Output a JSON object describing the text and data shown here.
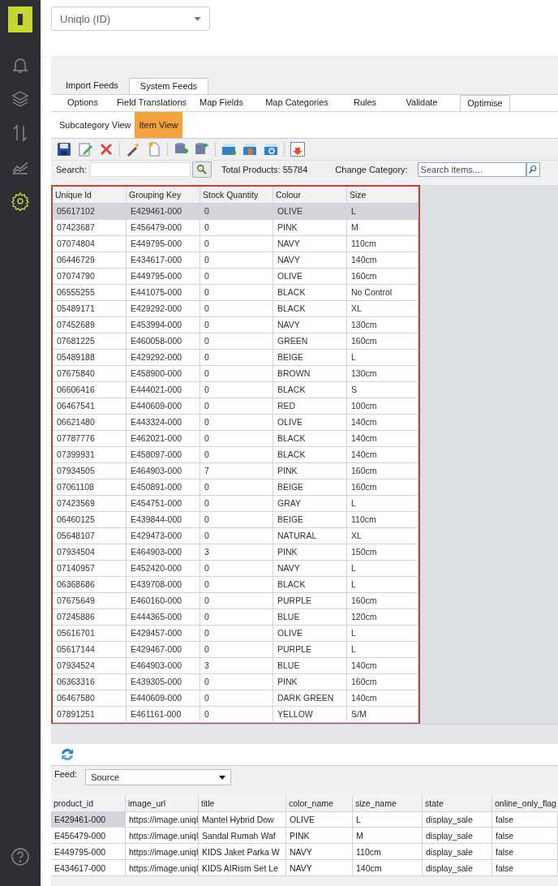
{
  "sidebar": {
    "items": [
      {
        "kind": "bell",
        "selected": false
      },
      {
        "kind": "layers",
        "selected": false
      },
      {
        "kind": "transfer",
        "selected": false
      },
      {
        "kind": "chart",
        "selected": false
      },
      {
        "kind": "gear",
        "selected": true
      }
    ],
    "bottom_items": [
      {
        "kind": "help"
      }
    ]
  },
  "store_select": {
    "value": "Uniqlo (ID)"
  },
  "feed_tabs": [
    {
      "label": "Import Feeds",
      "selected": false
    },
    {
      "label": "System Feeds",
      "selected": true
    }
  ],
  "step_tabs": [
    {
      "label": "Options",
      "selected": false
    },
    {
      "label": "Field Translations",
      "selected": false
    },
    {
      "label": "Map Fields",
      "selected": false
    },
    {
      "label": "Map Categories",
      "selected": false
    },
    {
      "label": "Rules",
      "selected": false
    },
    {
      "label": "Validate",
      "selected": false
    },
    {
      "label": "Optimise",
      "selected": true
    }
  ],
  "view_tabs": [
    {
      "label": "Subcategory View",
      "selected": false
    },
    {
      "label": "Item View",
      "selected": true
    }
  ],
  "search_bar": {
    "search_label": "Search:",
    "total": "Total Products: 55784",
    "category_label": "Change Category:",
    "items_placeholder": "Search items...."
  },
  "table": {
    "columns": [
      "Unique Id",
      "Grouping Key",
      "Stock Quantity",
      "Colour",
      "Size"
    ],
    "rows": [
      {
        "cells": [
          "05617102",
          "E429461-000",
          "0",
          "OLIVE",
          "L"
        ],
        "selected": true
      },
      {
        "cells": [
          "07423687",
          "E456479-000",
          "0",
          "PINK",
          "M"
        ],
        "selected": false
      },
      {
        "cells": [
          "07074804",
          "E449795-000",
          "0",
          "NAVY",
          "110cm"
        ],
        "selected": false
      },
      {
        "cells": [
          "06446729",
          "E434617-000",
          "0",
          "NAVY",
          "140cm"
        ],
        "selected": false
      },
      {
        "cells": [
          "07074790",
          "E449795-000",
          "0",
          "OLIVE",
          "160cm"
        ],
        "selected": false
      },
      {
        "cells": [
          "06555255",
          "E441075-000",
          "0",
          "BLACK",
          "No Control"
        ],
        "selected": false
      },
      {
        "cells": [
          "05489171",
          "E429292-000",
          "0",
          "BLACK",
          "XL"
        ],
        "selected": false
      },
      {
        "cells": [
          "07452689",
          "E453994-000",
          "0",
          "NAVY",
          "130cm"
        ],
        "selected": false
      },
      {
        "cells": [
          "07681225",
          "E460058-000",
          "0",
          "GREEN",
          "160cm"
        ],
        "selected": false
      },
      {
        "cells": [
          "05489188",
          "E429292-000",
          "0",
          "BEIGE",
          "L"
        ],
        "selected": false
      },
      {
        "cells": [
          "07675840",
          "E458900-000",
          "0",
          "BROWN",
          "130cm"
        ],
        "selected": false
      },
      {
        "cells": [
          "06606416",
          "E444021-000",
          "0",
          "BLACK",
          "S"
        ],
        "selected": false
      },
      {
        "cells": [
          "06467541",
          "E440609-000",
          "0",
          "RED",
          "100cm"
        ],
        "selected": false
      },
      {
        "cells": [
          "06621480",
          "E443324-000",
          "0",
          "OLIVE",
          "140cm"
        ],
        "selected": false
      },
      {
        "cells": [
          "07787776",
          "E462021-000",
          "0",
          "BLACK",
          "140cm"
        ],
        "selected": false
      },
      {
        "cells": [
          "07399931",
          "E458097-000",
          "0",
          "BLACK",
          "140cm"
        ],
        "selected": false
      },
      {
        "cells": [
          "07934505",
          "E464903-000",
          "7",
          "PINK",
          "160cm"
        ],
        "selected": false
      },
      {
        "cells": [
          "07061108",
          "E450891-000",
          "0",
          "BEIGE",
          "160cm"
        ],
        "selected": false
      },
      {
        "cells": [
          "07423569",
          "E454751-000",
          "0",
          "GRAY",
          "L"
        ],
        "selected": false
      },
      {
        "cells": [
          "06460125",
          "E439844-000",
          "0",
          "BEIGE",
          "110cm"
        ],
        "selected": false
      },
      {
        "cells": [
          "05648107",
          "E429473-000",
          "0",
          "NATURAL",
          "XL"
        ],
        "selected": false
      },
      {
        "cells": [
          "07934504",
          "E464903-000",
          "3",
          "PINK",
          "150cm"
        ],
        "selected": false
      },
      {
        "cells": [
          "07140957",
          "E452420-000",
          "0",
          "NAVY",
          "L"
        ],
        "selected": false
      },
      {
        "cells": [
          "06368686",
          "E439708-000",
          "0",
          "BLACK",
          "L"
        ],
        "selected": false
      },
      {
        "cells": [
          "07675649",
          "E460160-000",
          "0",
          "PURPLE",
          "160cm"
        ],
        "selected": false
      },
      {
        "cells": [
          "07245886",
          "E444365-000",
          "0",
          "BLUE",
          "120cm"
        ],
        "selected": false
      },
      {
        "cells": [
          "05616701",
          "E429457-000",
          "0",
          "OLIVE",
          "L"
        ],
        "selected": false
      },
      {
        "cells": [
          "05617144",
          "E429467-000",
          "0",
          "PURPLE",
          "L"
        ],
        "selected": false
      },
      {
        "cells": [
          "07934524",
          "E464903-000",
          "3",
          "BLUE",
          "140cm"
        ],
        "selected": false
      },
      {
        "cells": [
          "06363316",
          "E439305-000",
          "0",
          "PINK",
          "160cm"
        ],
        "selected": false
      },
      {
        "cells": [
          "06467580",
          "E440609-000",
          "0",
          "DARK GREEN",
          "140cm"
        ],
        "selected": false
      },
      {
        "cells": [
          "07891251",
          "E461161-000",
          "0",
          "YELLOW",
          "S/M"
        ],
        "selected": false
      }
    ]
  },
  "feed": {
    "label": "Feed:",
    "value": "Source"
  },
  "feed_table": {
    "columns": [
      "product_id",
      "image_url",
      "title",
      "color_name",
      "size_name",
      "state",
      "online_only_flag"
    ],
    "rows": [
      {
        "cells": [
          "E429461-000",
          "https://image.uniql",
          "Mantel Hybrid Dow",
          "OLIVE",
          "L",
          "display_sale",
          "false"
        ],
        "selected": true
      },
      {
        "cells": [
          "E456479-000",
          "https://image.uniql",
          "Sandal Rumah Waf",
          "PINK",
          "M",
          "display_sale",
          "false"
        ],
        "selected": false
      },
      {
        "cells": [
          "E449795-000",
          "https://image.uniql",
          "KIDS Jaket Parka W",
          "NAVY",
          "110cm",
          "display_sale",
          "false"
        ],
        "selected": false
      },
      {
        "cells": [
          "E434617-000",
          "https://image.uniql",
          "KIDS AIRism Set Le",
          "NAVY",
          "140cm",
          "display_sale",
          "false"
        ],
        "selected": false
      }
    ]
  }
}
